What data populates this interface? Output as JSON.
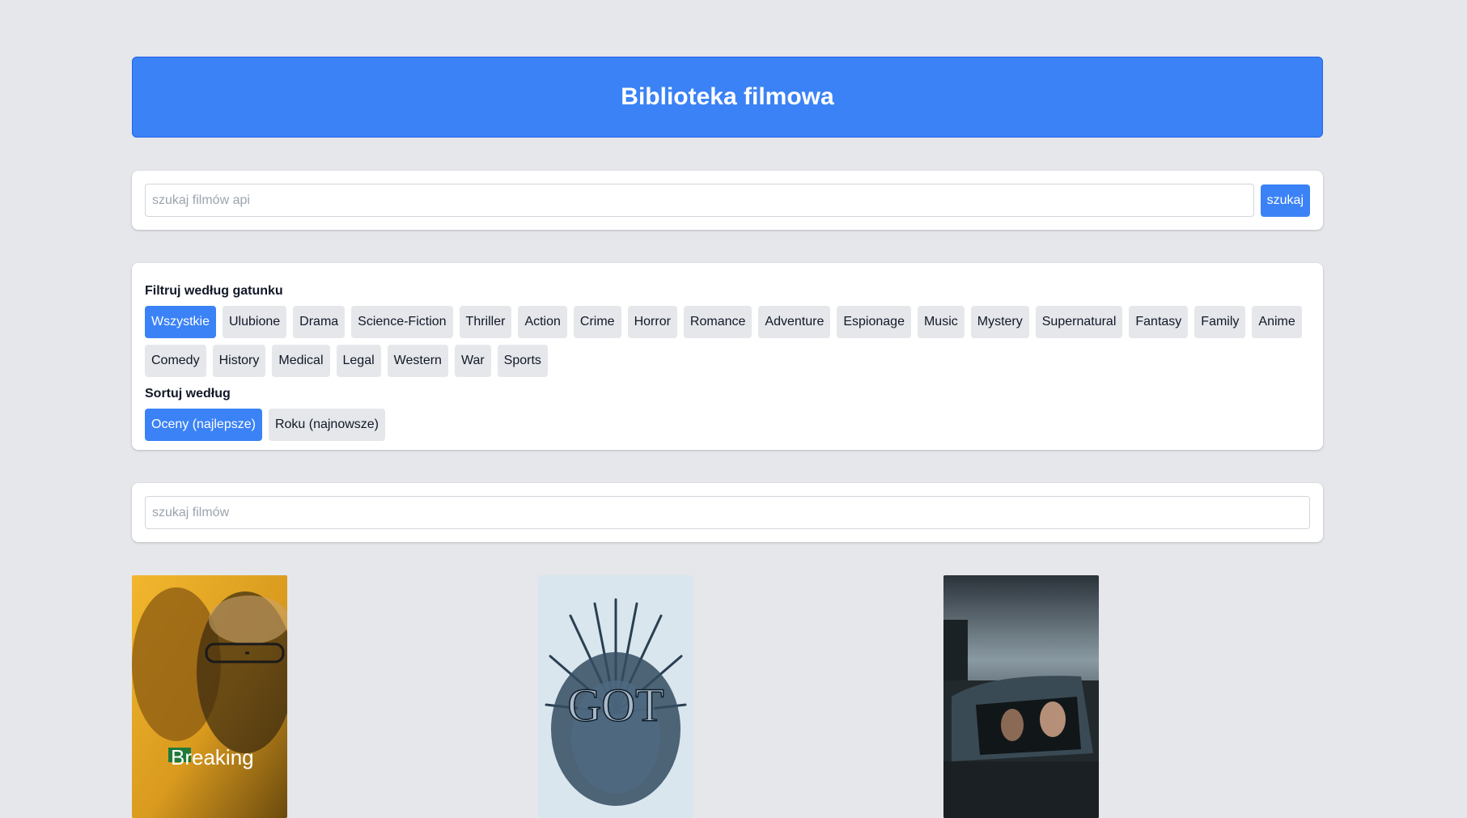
{
  "header": {
    "title": "Biblioteka filmowa"
  },
  "api_search": {
    "placeholder": "szukaj filmów api",
    "value": "",
    "button_label": "szukaj"
  },
  "filters": {
    "genre_label": "Filtruj według gatunku",
    "genres": [
      {
        "label": "Wszystkie",
        "active": true
      },
      {
        "label": "Ulubione",
        "active": false
      },
      {
        "label": "Drama",
        "active": false
      },
      {
        "label": "Science-Fiction",
        "active": false
      },
      {
        "label": "Thriller",
        "active": false
      },
      {
        "label": "Action",
        "active": false
      },
      {
        "label": "Crime",
        "active": false
      },
      {
        "label": "Horror",
        "active": false
      },
      {
        "label": "Romance",
        "active": false
      },
      {
        "label": "Adventure",
        "active": false
      },
      {
        "label": "Espionage",
        "active": false
      },
      {
        "label": "Music",
        "active": false
      },
      {
        "label": "Mystery",
        "active": false
      },
      {
        "label": "Supernatural",
        "active": false
      },
      {
        "label": "Fantasy",
        "active": false
      },
      {
        "label": "Family",
        "active": false
      },
      {
        "label": "Anime",
        "active": false
      },
      {
        "label": "Comedy",
        "active": false
      },
      {
        "label": "History",
        "active": false
      },
      {
        "label": "Medical",
        "active": false
      },
      {
        "label": "Legal",
        "active": false
      },
      {
        "label": "Western",
        "active": false
      },
      {
        "label": "War",
        "active": false
      },
      {
        "label": "Sports",
        "active": false
      }
    ],
    "sort_label": "Sortuj według",
    "sort_options": [
      {
        "label": "Oceny (najlepsze)",
        "active": true
      },
      {
        "label": "Roku (najnowsze)",
        "active": false
      }
    ]
  },
  "local_search": {
    "placeholder": "szukaj filmów",
    "value": ""
  },
  "movies": [
    {
      "poster_text": "Breaking"
    },
    {
      "poster_text": "GOT"
    },
    {
      "poster_text": ""
    }
  ],
  "colors": {
    "accent": "#3b82f6",
    "background": "#e5e7eb",
    "chip": "#e5e7eb"
  }
}
